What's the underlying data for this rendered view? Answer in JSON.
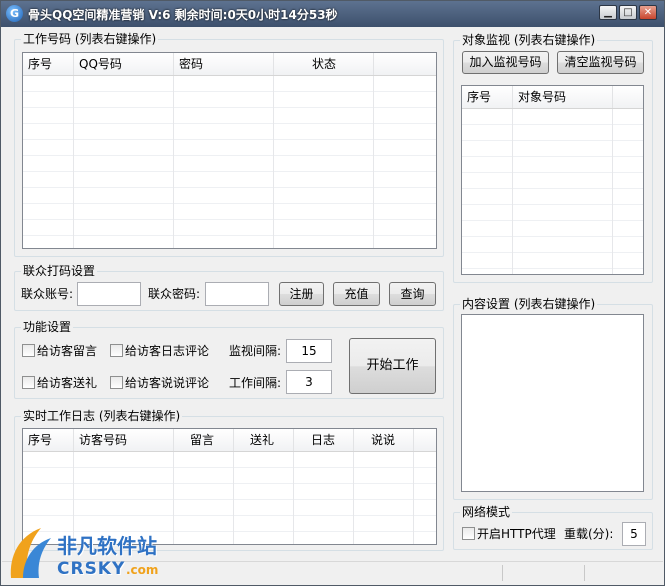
{
  "window": {
    "title": "骨头QQ空间精准营销 V:6 剩余时间:0天0小时14分53秒",
    "icon_letter": "G",
    "min_glyph": "▁",
    "max_glyph": "□",
    "close_glyph": "✕"
  },
  "work_accounts": {
    "title": "工作号码 (列表右键操作)",
    "columns": [
      "序号",
      "QQ号码",
      "密码",
      "状态"
    ]
  },
  "captcha": {
    "title": "联众打码设置",
    "account_label": "联众账号:",
    "account_value": "",
    "password_label": "联众密码:",
    "password_value": "",
    "register_label": "注册",
    "recharge_label": "充值",
    "query_label": "查询"
  },
  "functions": {
    "title": "功能设置",
    "cb_message": "给访客留言",
    "cb_blog_comment": "给访客日志评论",
    "cb_gift": "给访客送礼",
    "cb_shuoshuo_comment": "给访客说说评论",
    "monitor_interval_label": "监视间隔:",
    "monitor_interval_value": "15",
    "work_interval_label": "工作间隔:",
    "work_interval_value": "3",
    "start_label": "开始工作"
  },
  "log": {
    "title": "实时工作日志 (列表右键操作)",
    "columns": [
      "序号",
      "访客号码",
      "留言",
      "送礼",
      "日志",
      "说说"
    ]
  },
  "monitor": {
    "title": "对象监视 (列表右键操作)",
    "add_label": "加入监视号码",
    "clear_label": "清空监视号码",
    "columns": [
      "序号",
      "对象号码"
    ]
  },
  "content": {
    "title": "内容设置 (列表右键操作)",
    "text": ""
  },
  "network": {
    "title": "网络模式",
    "http_proxy_label": "开启HTTP代理",
    "reload_label": "重载(分):",
    "reload_value": "5"
  },
  "watermark": {
    "cn": "非凡软件站",
    "en": "CRSKY",
    "domain": ".com"
  }
}
